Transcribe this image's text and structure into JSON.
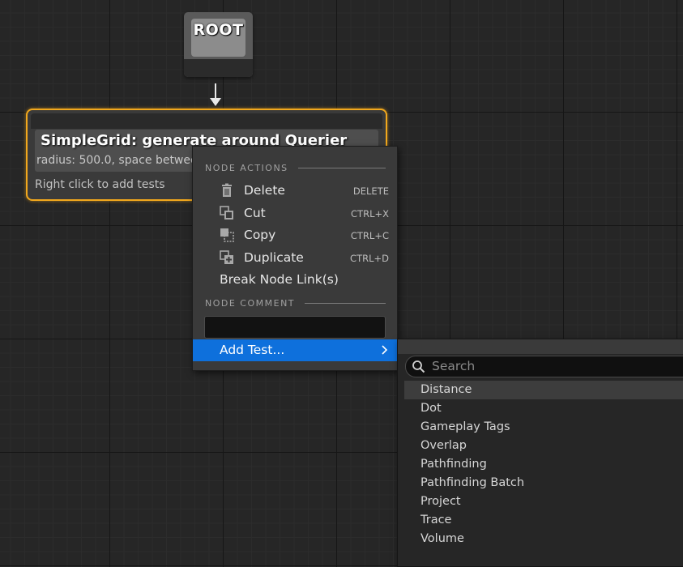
{
  "graph": {
    "root_node": {
      "label": "ROOT"
    },
    "generator_node": {
      "title": "SimpleGrid: generate around Querier",
      "subtitle": "radius: 500.0, space between",
      "hint": "Right click to add tests"
    }
  },
  "context_menu": {
    "node_actions_header": "NODE ACTIONS",
    "items": [
      {
        "label": "Delete",
        "shortcut": "DELETE",
        "icon": "trash-icon"
      },
      {
        "label": "Cut",
        "shortcut": "CTRL+X",
        "icon": "cut-icon"
      },
      {
        "label": "Copy",
        "shortcut": "CTRL+C",
        "icon": "copy-icon"
      },
      {
        "label": "Duplicate",
        "shortcut": "CTRL+D",
        "icon": "duplicate-icon"
      },
      {
        "label": "Break Node Link(s)"
      }
    ],
    "node_comment_header": "NODE COMMENT",
    "comment_value": "",
    "add_test_label": "Add Test...",
    "add_test_icon": "chevron-right-icon",
    "highlight_color": "#0e70dc"
  },
  "submenu": {
    "search_placeholder": "Search",
    "search_value": "",
    "items": [
      "Distance",
      "Dot",
      "Gameplay Tags",
      "Overlap",
      "Pathfinding",
      "Pathfinding Batch",
      "Project",
      "Trace",
      "Volume"
    ]
  },
  "colors": {
    "selection_outline": "#f2a81d",
    "canvas": "#262626"
  }
}
